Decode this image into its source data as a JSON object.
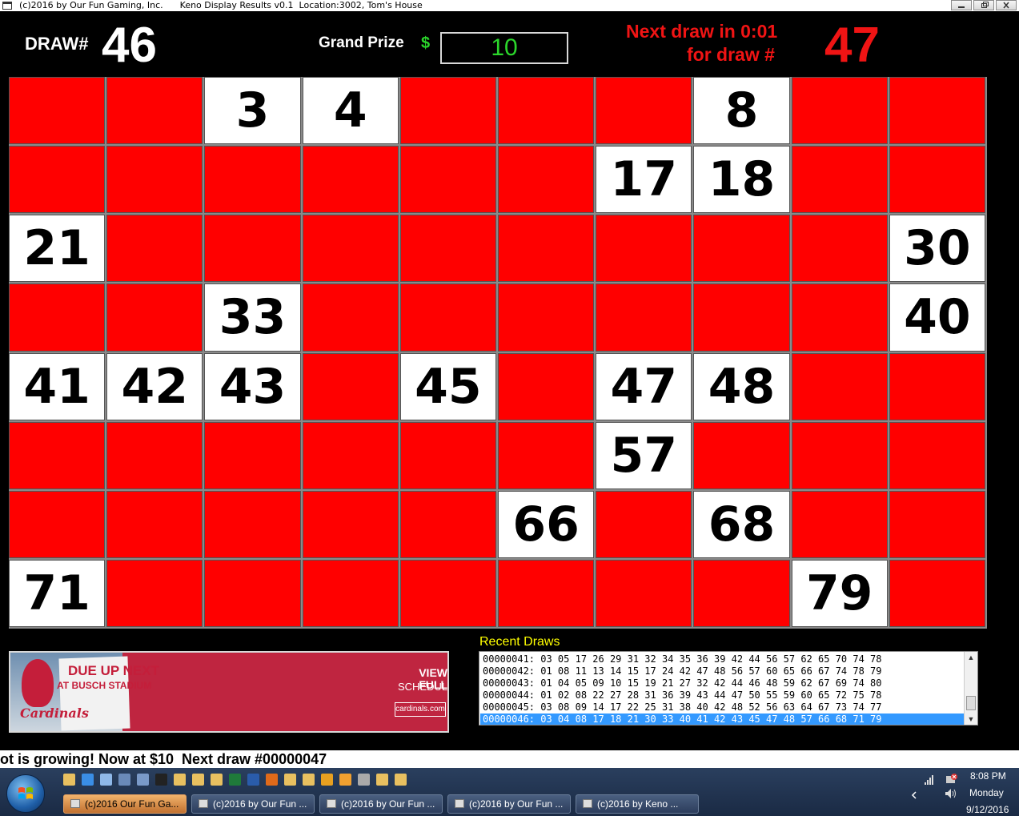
{
  "window": {
    "title": "(c)2016 by Our Fun Gaming, Inc.      Keno Display Results v0.1  Location:3002, Tom's House"
  },
  "header": {
    "draw_label": "DRAW#",
    "draw_number": "46",
    "grand_prize_label": "Grand Prize",
    "currency_symbol": "$",
    "grand_prize_value": "10",
    "next_draw_line1": "Next draw in 0:01",
    "next_draw_line2": "for draw #",
    "next_draw_number": "47"
  },
  "board": {
    "rows": 8,
    "columns": 10,
    "drawn_numbers": [
      3,
      4,
      8,
      17,
      18,
      21,
      30,
      33,
      40,
      41,
      42,
      43,
      45,
      47,
      48,
      57,
      66,
      68,
      71,
      79
    ],
    "colors": {
      "undrawn": "#ff0000",
      "drawn": "#ffffff"
    }
  },
  "banner": {
    "headline_line1": "DUE UP NEXT",
    "headline_line2": "AT BUSCH STADIUM",
    "cta_line1": "VIEW FULL",
    "cta_line2": "SCHEDULE »",
    "site": "cardinals.com",
    "logo": "Cardinals"
  },
  "recent_draws": {
    "label": "Recent Draws",
    "rows": [
      "00000041: 03 05 17 26 29 31 32 34 35 36 39 42 44 56 57 62 65 70 74 78",
      "00000042: 01 08 11 13 14 15 17 24 42 47 48 56 57 60 65 66 67 74 78 79",
      "00000043: 01 04 05 09 10 15 19 21 27 32 42 44 46 48 59 62 67 69 74 80",
      "00000044: 01 02 08 22 27 28 31 36 39 43 44 47 50 55 59 60 65 72 75 78",
      "00000045: 03 08 09 14 17 22 25 31 38 40 42 48 52 56 63 64 67 73 74 77",
      "00000046: 03 04 08 17 18 21 30 33 40 41 42 43 45 47 48 57 66 68 71 79"
    ],
    "selected_index": 5
  },
  "ticker": {
    "text": "ot is growing! Now at $10  Next draw #00000047"
  },
  "taskbar": {
    "tasks": [
      "(c)2016 Our Fun Ga...",
      "(c)2016 by Our Fun ...",
      "(c)2016 by Our Fun ...",
      "(c)2016 by Our Fun ...",
      "(c)2016 by     Keno ..."
    ],
    "active_task_index": 0,
    "clock_time": "8:08 PM",
    "clock_day": "Monday",
    "clock_date": "9/12/2016"
  }
}
